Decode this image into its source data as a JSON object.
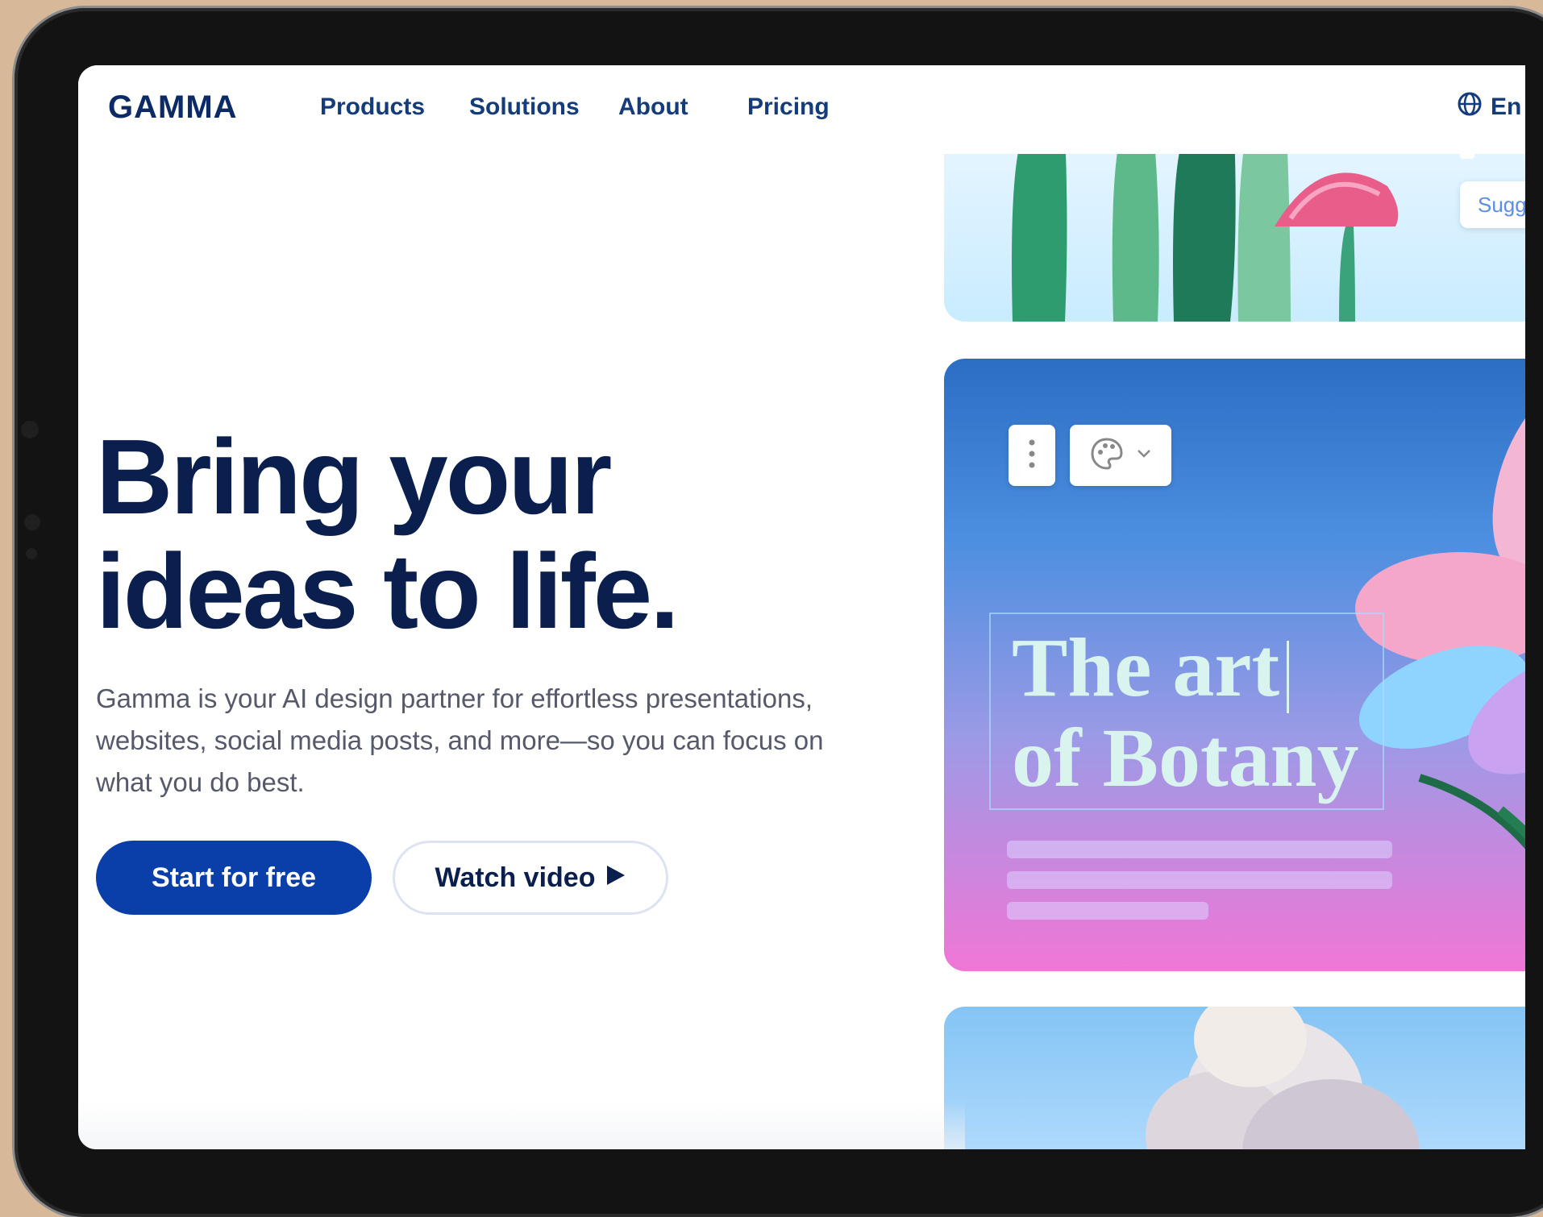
{
  "nav": {
    "logo": "GAMMA",
    "links": [
      "Products",
      "Solutions",
      "About",
      "Pricing"
    ],
    "language": "En"
  },
  "hero": {
    "title_line1": "Bring your",
    "title_line2": "ideas to life.",
    "subtitle": "Gamma is your AI design partner for effortless presentations, websites, social media posts, and more—so you can focus on what you do best.",
    "primary_cta": "Start for free",
    "secondary_cta": "Watch video"
  },
  "preview": {
    "suggest_label": "Sugge",
    "card_title_line1": "The art",
    "card_title_line2": "of Botany"
  },
  "colors": {
    "brand_navy": "#0a1f4d",
    "primary_button": "#0a3ea8",
    "device_frame": "#131313",
    "backdrop": "#d7b99a"
  }
}
